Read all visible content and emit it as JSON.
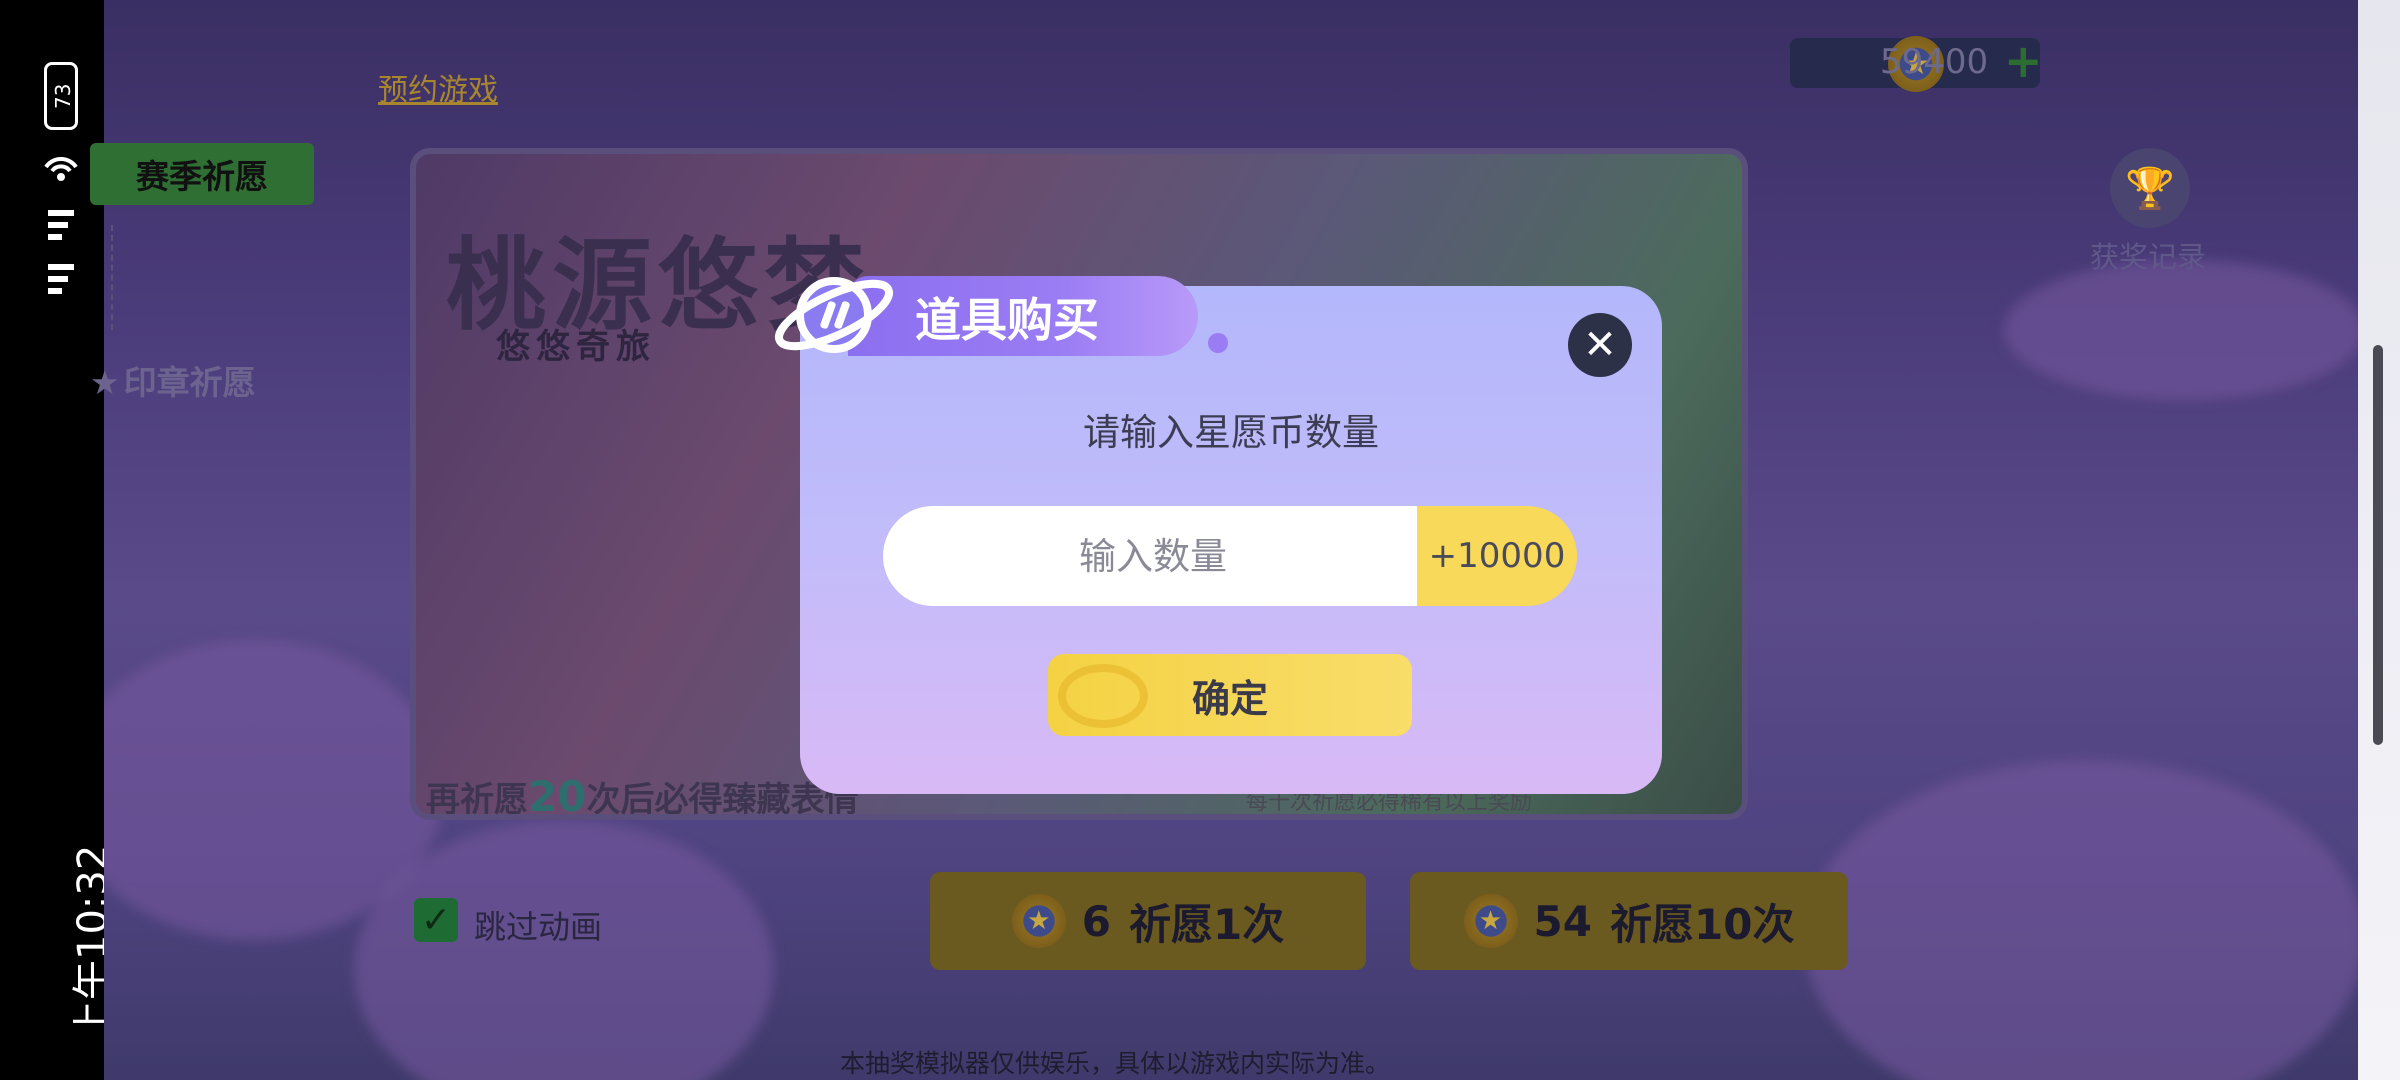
{
  "status_bar": {
    "time": "上午10:32",
    "battery": "73"
  },
  "game": {
    "reserve_link": "预约游戏",
    "tabs": {
      "season": "赛季祈愿",
      "stamp": "印章祈愿"
    },
    "currency": {
      "amount": "59400",
      "plus": "+"
    },
    "award_record": "获奖记录",
    "banner": {
      "title": "桃源悠梦",
      "subtitle": "悠悠奇旅",
      "guarantee_prefix": "再祈愿",
      "guarantee_count": "20",
      "guarantee_suffix": "次后必得臻藏表情",
      "hint": "每十次祈愿必得稀有以上奖励"
    },
    "skip_animation": {
      "label": "跳过动画",
      "checked": true
    },
    "wish_buttons": [
      {
        "cost": "6",
        "label": "祈愿1次"
      },
      {
        "cost": "54",
        "label": "祈愿10次"
      }
    ],
    "disclaimer": "本抽奖模拟器仅供娱乐，具体以游戏内实际为准。"
  },
  "dialog": {
    "title": "道具购买",
    "prompt": "请输入星愿币数量",
    "input_placeholder": "输入数量",
    "input_value": "",
    "add_button": "+10000",
    "confirm_button": "确定",
    "close_icon": "close-icon"
  },
  "colors": {
    "dialog_top": "#b3b7fb",
    "dialog_bottom": "#d8b9f5",
    "accent_yellow": "#f8d95a",
    "header_purple": "#8c6ff0"
  }
}
